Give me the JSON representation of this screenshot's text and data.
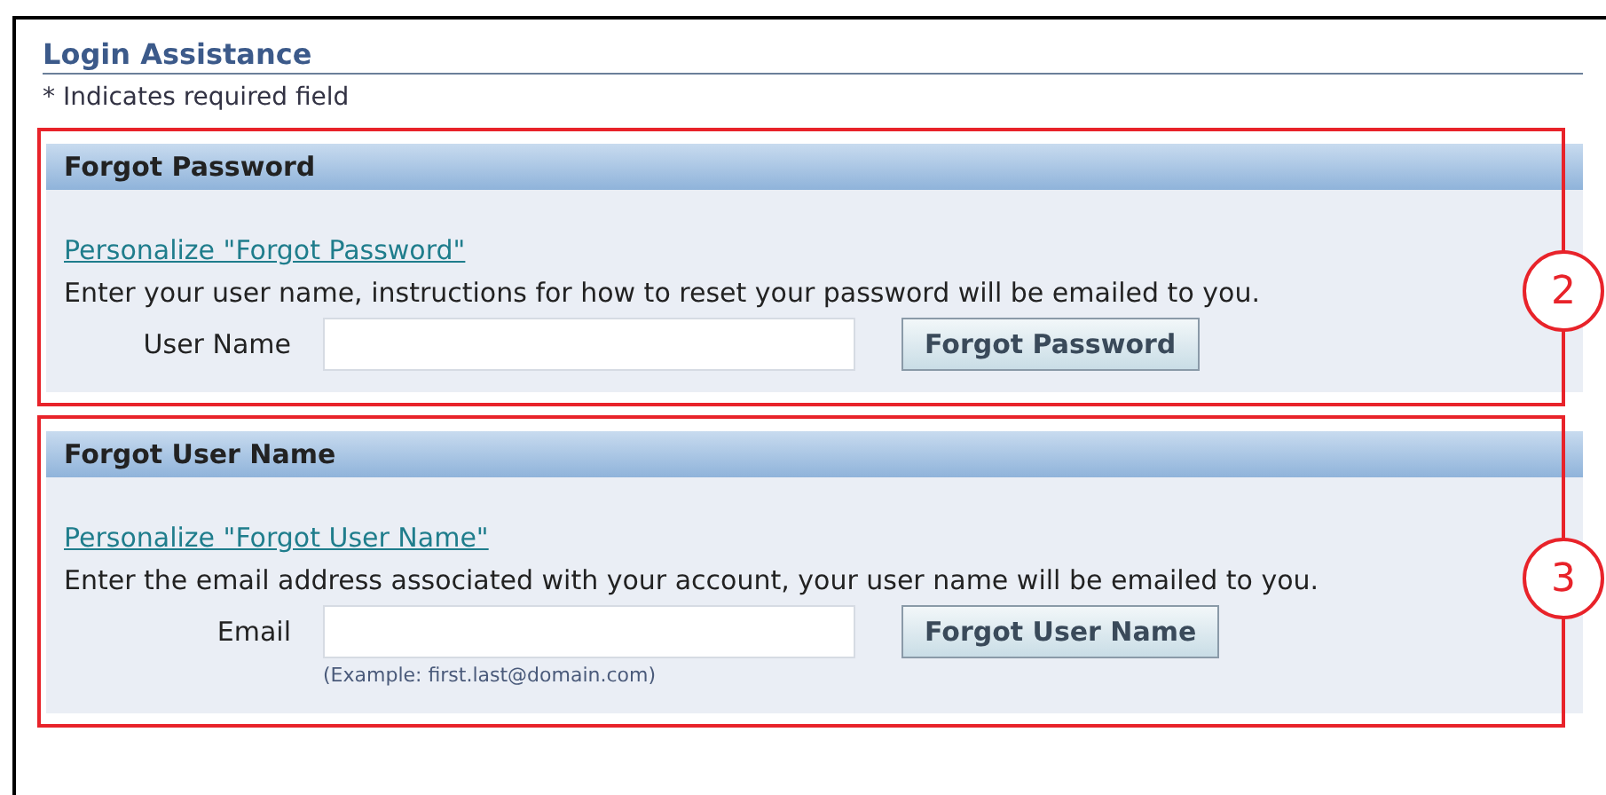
{
  "title": "Login Assistance",
  "required_note": "* Indicates required field",
  "sections": [
    {
      "heading": "Forgot Password",
      "link": "Personalize \"Forgot Password\"",
      "instruction": "Enter your user name, instructions for how to reset your password will be emailed to you.",
      "field_label": "User Name",
      "button": "Forgot Password",
      "callout": "2"
    },
    {
      "heading": "Forgot User Name",
      "link": "Personalize \"Forgot User Name\"",
      "instruction": "Enter the email address associated with your account, your user name will be emailed to you.",
      "field_label": "Email",
      "hint": "(Example: first.last@domain.com)",
      "button": "Forgot User Name",
      "callout": "3"
    }
  ]
}
